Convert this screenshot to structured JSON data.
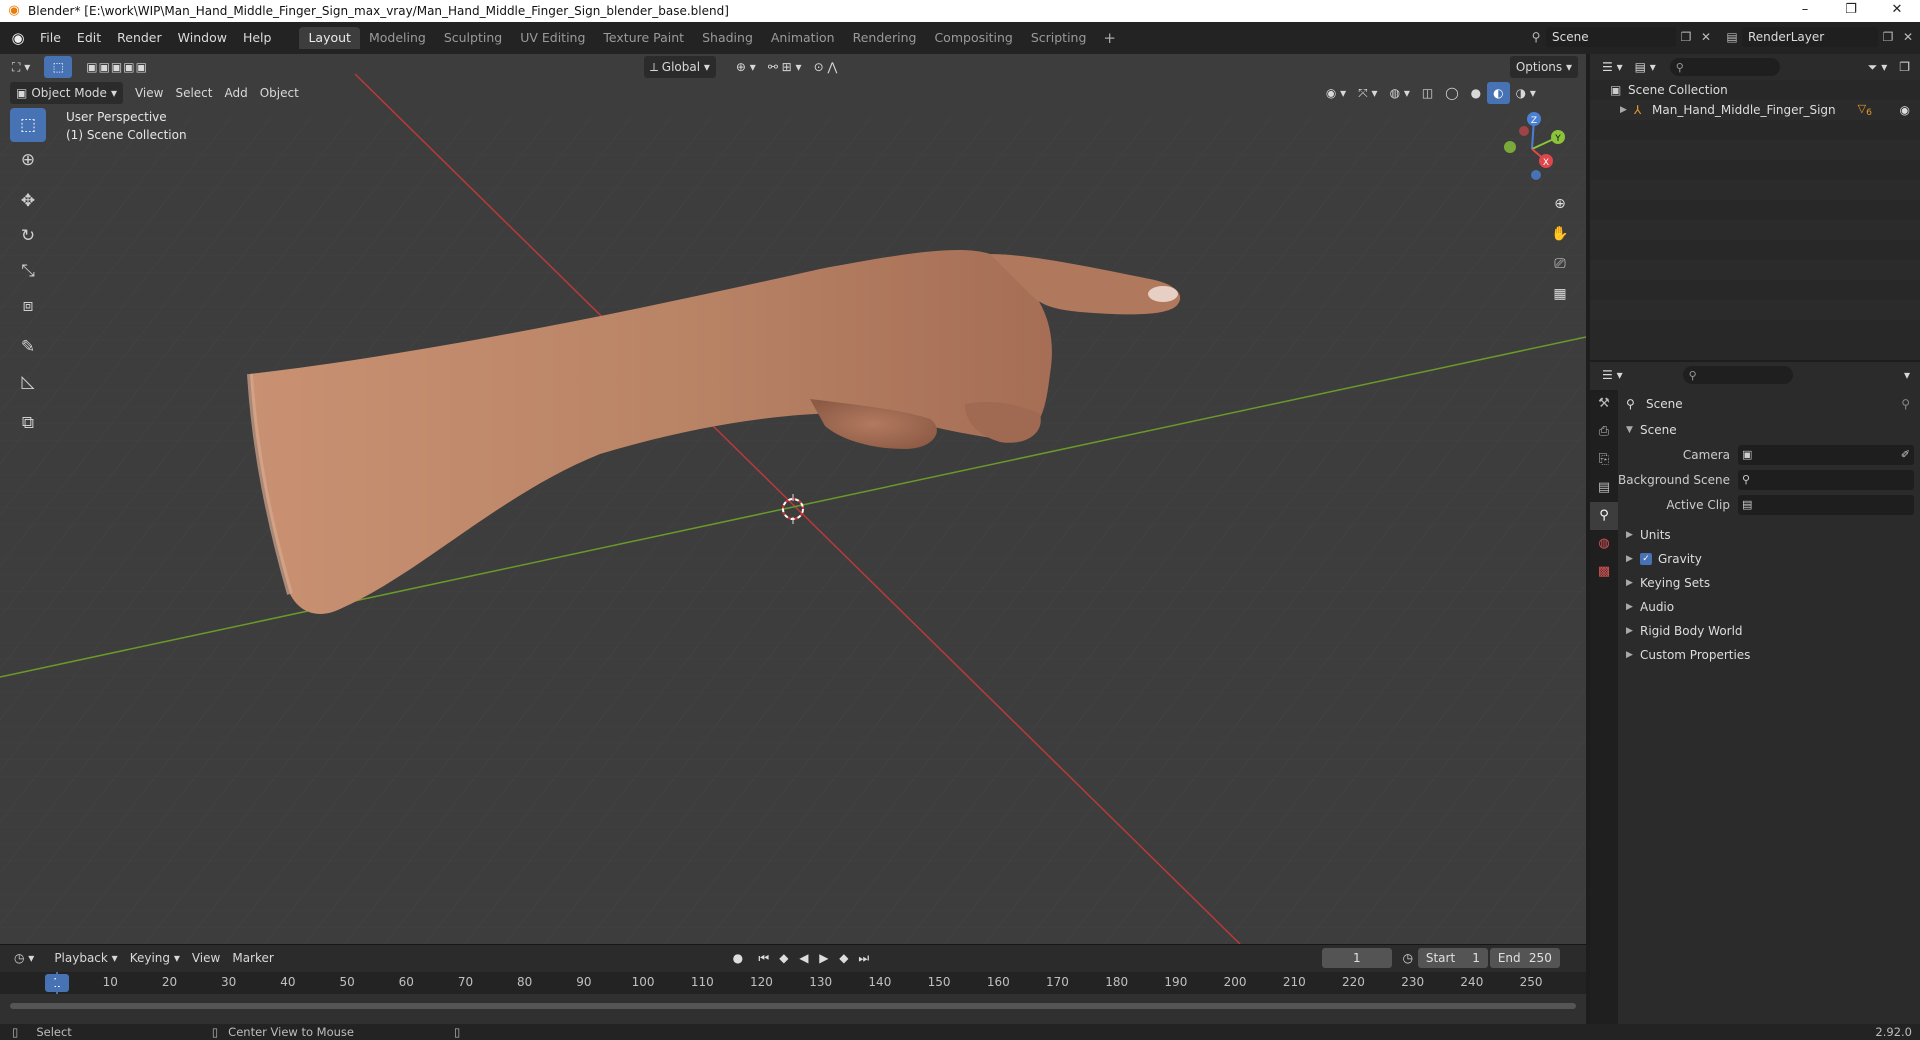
{
  "window": {
    "title": "Blender* [E:\\work\\WIP\\Man_Hand_Middle_Finger_Sign_max_vray/Man_Hand_Middle_Finger_Sign_blender_base.blend]",
    "minimize": "–",
    "restore": "❐",
    "close": "✕"
  },
  "topbar": {
    "menus": [
      "File",
      "Edit",
      "Render",
      "Window",
      "Help"
    ],
    "workspaces": [
      "Layout",
      "Modeling",
      "Sculpting",
      "UV Editing",
      "Texture Paint",
      "Shading",
      "Animation",
      "Rendering",
      "Compositing",
      "Scripting"
    ],
    "active_workspace": "Layout",
    "add_workspace": "+",
    "scene": "Scene",
    "view_layer": "RenderLayer"
  },
  "viewport": {
    "mode": "Object Mode",
    "menus": [
      "View",
      "Select",
      "Add",
      "Object"
    ],
    "orientation": "Global",
    "options": "Options",
    "perspective": "User Perspective",
    "collection": "(1) Scene Collection",
    "gizmo_axes": [
      "X",
      "Y",
      "Z"
    ],
    "colors": {
      "grid_bg": "#3d3d3d",
      "x_axis": "#b83a3a",
      "y_axis": "#6a9a2a",
      "accent": "#4772b3"
    }
  },
  "tools": [
    "select-box-icon",
    "cursor-icon",
    "move-icon",
    "rotate-icon",
    "scale-icon",
    "transform-icon",
    "annotate-icon",
    "measure-icon",
    "add-cube-icon"
  ],
  "timeline": {
    "menus": [
      "Playback",
      "Keying",
      "View",
      "Marker"
    ],
    "current_frame": "1",
    "start_label": "Start",
    "start": "1",
    "end_label": "End",
    "end": "250",
    "ticks": [
      "10",
      "20",
      "30",
      "40",
      "50",
      "60",
      "70",
      "80",
      "90",
      "100",
      "110",
      "120",
      "130",
      "140",
      "150",
      "160",
      "170",
      "180",
      "190",
      "200",
      "210",
      "220",
      "230",
      "240",
      "250"
    ],
    "playhead": "1"
  },
  "statusbar": {
    "select": "Select",
    "center_view": "Center View to Mouse",
    "version": "2.92.0"
  },
  "outliner": {
    "root": "Scene Collection",
    "object": "Man_Hand_Middle_Finger_Sign",
    "modifier_count": "6"
  },
  "properties": {
    "context": "Scene",
    "panel": "Scene",
    "fields": [
      {
        "label": "Camera"
      },
      {
        "label": "Background Scene"
      },
      {
        "label": "Active Clip"
      }
    ],
    "subpanels": [
      "Units",
      "Gravity",
      "Keying Sets",
      "Audio",
      "Rigid Body World",
      "Custom Properties"
    ],
    "gravity_checked": true
  }
}
